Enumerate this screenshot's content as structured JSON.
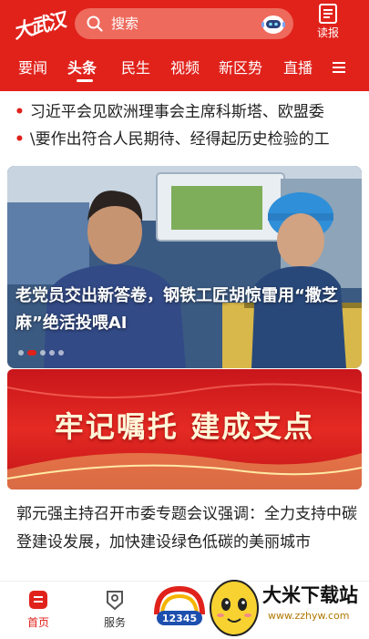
{
  "header": {
    "logo_text": "大武汉",
    "search_placeholder": "搜索",
    "read_paper_label": "读报",
    "accent_color": "#e0221b"
  },
  "nav": {
    "tabs": [
      "要闻",
      "头条",
      "民生",
      "视频",
      "新区势",
      "直播"
    ],
    "active_tab": "头条"
  },
  "ticker": {
    "items": [
      "习近平会见欧洲理事会主席科斯塔、欧盟委",
      "\\要作出符合人民期待、经得起历史检验的工"
    ]
  },
  "banner": {
    "title": "老党员交出新答卷，钢铁工匠胡惊雷用“撒芝麻”绝活投喂AI",
    "dot_count": 5,
    "active_dot": 1
  },
  "promo": {
    "text": "牢记嘱托 建成支点"
  },
  "news": {
    "title": "郭元强主持召开市委专题会议强调：全力支持中碳登建设发展，加快建设绿色低碳的美丽城市"
  },
  "tabbar": {
    "items": [
      "首页",
      "服务"
    ],
    "active": "首页",
    "hotline_number": "12345"
  },
  "watermark": {
    "name": "大米下载站",
    "url": "www.zzhyw.com"
  }
}
